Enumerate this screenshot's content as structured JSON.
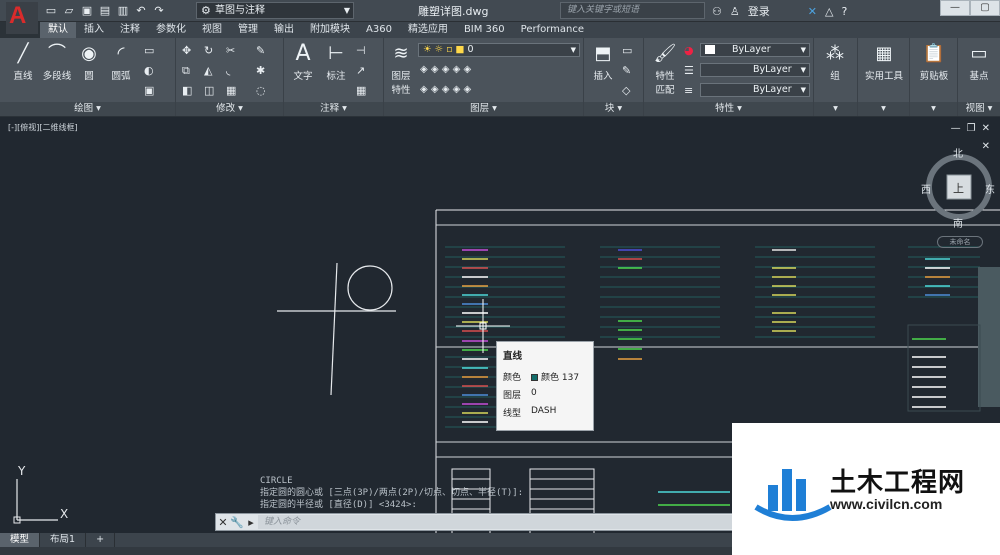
{
  "titlebar": {
    "workspace": "草图与注释",
    "document_title": "雕塑详图.dwg",
    "search_placeholder": "键入关键字或短语",
    "login_label": "登录"
  },
  "ribbon_tabs": [
    "默认",
    "插入",
    "注释",
    "参数化",
    "视图",
    "管理",
    "输出",
    "附加模块",
    "A360",
    "精选应用",
    "BIM 360",
    "Performance"
  ],
  "draw_panel": {
    "title": "绘图",
    "tools": [
      "直线",
      "多段线",
      "圆",
      "圆弧"
    ]
  },
  "modify_panel": {
    "title": "修改"
  },
  "annotation_panel": {
    "title": "注释",
    "tools": [
      "文字",
      "标注"
    ]
  },
  "layers_panel": {
    "title": "图层",
    "tool": "图层\n特性",
    "tool_line1": "图层",
    "tool_line2": "特性",
    "current_layer": "0"
  },
  "block_panel": {
    "title": "块",
    "tool": "插入"
  },
  "properties_panel": {
    "title": "特性",
    "match_line1": "特性",
    "match_line2": "匹配",
    "color": "ByLayer",
    "linetype": "ByLayer",
    "lineweight": "ByLayer"
  },
  "groups_panel": {
    "tool": "组"
  },
  "utilities_panel": {
    "tool": "实用工具"
  },
  "clipboard_panel": {
    "tool": "剪贴板"
  },
  "view_panel": {
    "title": "视图",
    "tool": "基点"
  },
  "viewport": {
    "label": "[-][俯视][二维线框]"
  },
  "viewcube": {
    "north": "北",
    "south": "南",
    "east": "东",
    "west": "西",
    "top": "上",
    "wcs": "未命名"
  },
  "ucs": {
    "x": "X",
    "y": "Y"
  },
  "command_history": [
    "CIRCLE",
    "指定圆的圆心或 [三点(3P)/两点(2P)/切点、切点、半径(T)]:",
    "指定圆的半径或 [直径(D)] <3424>:"
  ],
  "command_input_placeholder": "键入命令",
  "tooltip": {
    "title": "直线",
    "color_label": "颜色",
    "color_value": "颜色 137",
    "layer_label": "图层",
    "layer_value": "0",
    "linetype_label": "线型",
    "linetype_value": "DASH",
    "swatch": "#136d6a"
  },
  "layout_tabs": [
    "模型",
    "布局1",
    "+"
  ],
  "watermark": {
    "text": "土木工程网",
    "url": "www.civilcn.com"
  },
  "colors": {
    "accent": "#d92b2b",
    "canvas": "#212830"
  }
}
